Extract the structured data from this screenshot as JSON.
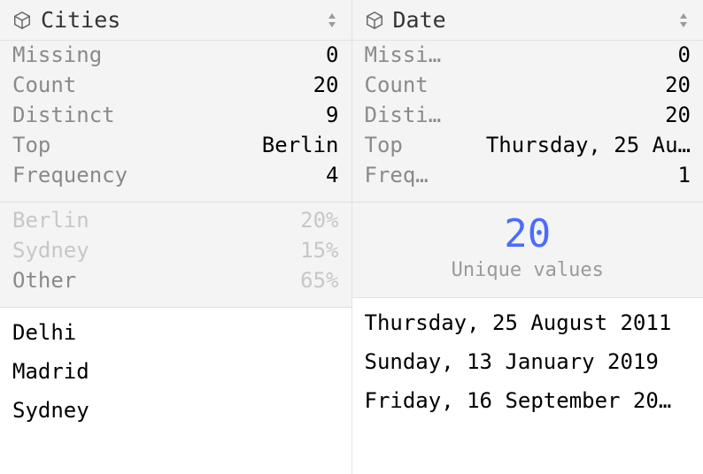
{
  "columns": [
    {
      "title": "Cities",
      "stats": [
        {
          "label": "Missing",
          "value": "0"
        },
        {
          "label": "Count",
          "value": "20"
        },
        {
          "label": "Distinct",
          "value": "9"
        },
        {
          "label": "Top",
          "value": "Berlin"
        },
        {
          "label": "Frequency",
          "value": "4"
        }
      ],
      "distribution": [
        {
          "label": "Berlin",
          "pct": "20%",
          "strong": false
        },
        {
          "label": "Sydney",
          "pct": "15%",
          "strong": false
        },
        {
          "label": "Other",
          "pct": "65%",
          "strong": true
        }
      ],
      "rows": [
        "Delhi",
        "Madrid",
        "Sydney"
      ]
    },
    {
      "title": "Date",
      "stats": [
        {
          "label": "Missi…",
          "value": "0"
        },
        {
          "label": "Count",
          "value": "20"
        },
        {
          "label": "Disti…",
          "value": "20"
        },
        {
          "label": "Top",
          "value": "Thursday, 25 Au…"
        },
        {
          "label": "Freq…",
          "value": "1"
        }
      ],
      "unique": {
        "number": "20",
        "caption": "Unique values"
      },
      "rows": [
        "Thursday, 25 August 2011",
        "Sunday, 13 January 2019",
        "Friday, 16 September 20…"
      ]
    }
  ]
}
